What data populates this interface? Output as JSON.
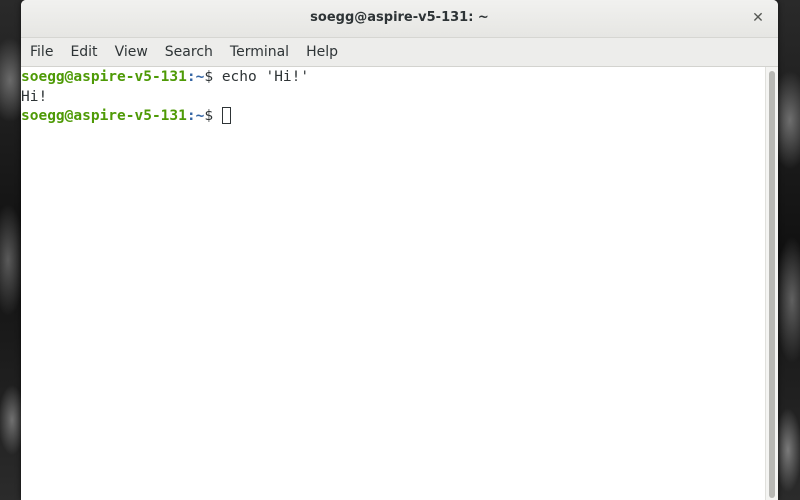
{
  "window": {
    "title": "soegg@aspire-v5-131: ~",
    "close_glyph": "✕"
  },
  "menubar": {
    "items": [
      "File",
      "Edit",
      "View",
      "Search",
      "Terminal",
      "Help"
    ]
  },
  "terminal": {
    "lines": [
      {
        "user_host": "soegg@aspire-v5-131",
        "colon": ":",
        "path": "~",
        "sign": "$ ",
        "command": "echo 'Hi!'"
      },
      {
        "output": "Hi!"
      },
      {
        "user_host": "soegg@aspire-v5-131",
        "colon": ":",
        "path": "~",
        "sign": "$ ",
        "command": ""
      }
    ]
  },
  "colors": {
    "prompt_user": "#4e9a06",
    "prompt_path": "#3465a4",
    "text": "#2e3436",
    "background": "#ffffff"
  },
  "icons": {
    "close": "close-icon"
  }
}
